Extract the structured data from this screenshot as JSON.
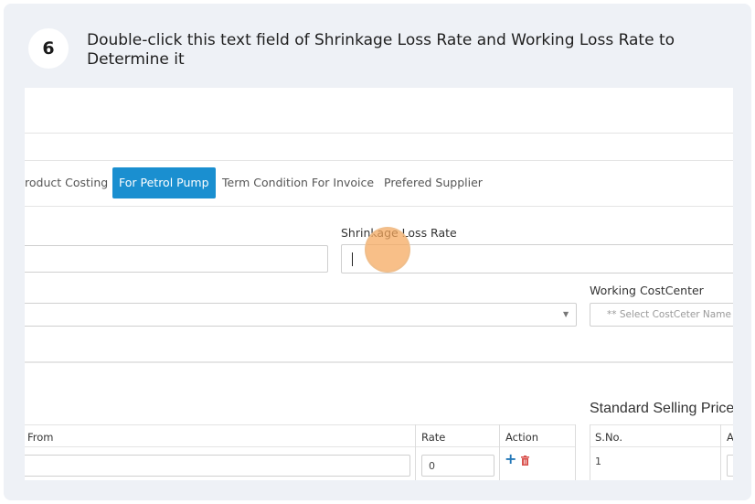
{
  "step": {
    "number": "6",
    "instruction": "Double-click this text field of Shrinkage Loss Rate and Working Loss Rate to Determine it"
  },
  "tabs": [
    {
      "label": "roduct Costing",
      "active": false
    },
    {
      "label": "For Petrol Pump",
      "active": true
    },
    {
      "label": "Term Condition For Invoice",
      "active": false
    },
    {
      "label": "Prefered Supplier",
      "active": false
    }
  ],
  "form": {
    "shrinkage_label": "Shrinkage Loss Rate",
    "shrinkage_value": "",
    "working_costcenter_label": "Working CostCenter",
    "working_costcenter_placeholder": "** Select CostCeter Name"
  },
  "section": {
    "standard_selling_price_title": "Standard Selling Price"
  },
  "table_left": {
    "headers": [
      "From",
      "Rate",
      "Action"
    ],
    "row": {
      "rate": "0"
    }
  },
  "table_right": {
    "headers": [
      "S.No.",
      "A"
    ],
    "row": {
      "sno": "1"
    }
  },
  "colors": {
    "accent": "#1a8fd0",
    "click_marker": "#f5a65a",
    "add_icon": "#2478b8",
    "delete_icon": "#d9534f"
  }
}
